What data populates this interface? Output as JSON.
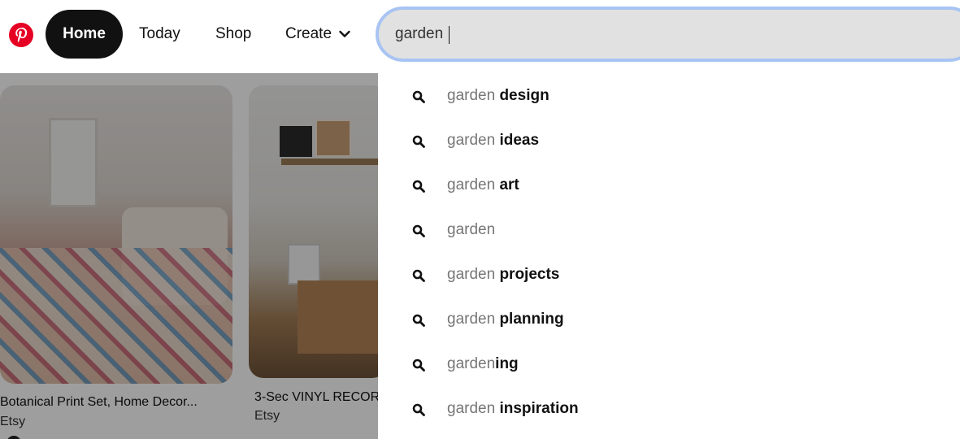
{
  "header": {
    "logo": "pinterest-logo",
    "nav": {
      "home": "Home",
      "today": "Today",
      "shop": "Shop",
      "create": "Create"
    },
    "search": {
      "value": "garden"
    }
  },
  "feed": {
    "pins": [
      {
        "title": "Botanical Print Set, Home Decor...",
        "source": "Etsy"
      },
      {
        "title": "3-Sec VINYL RECOR",
        "source": "Etsy"
      }
    ]
  },
  "suggestions": [
    {
      "base": "garden",
      "rest": " design"
    },
    {
      "base": "garden",
      "rest": " ideas"
    },
    {
      "base": "garden",
      "rest": " art"
    },
    {
      "base": "garden",
      "rest": ""
    },
    {
      "base": "garden",
      "rest": " projects"
    },
    {
      "base": "garden",
      "rest": " planning"
    },
    {
      "base": "garden",
      "rest": "ing"
    },
    {
      "base": "garden",
      "rest": " inspiration"
    }
  ],
  "colors": {
    "brand": "#e60023",
    "nav_active_bg": "#111111",
    "search_bg": "#e1e1e1",
    "search_focus": "#a8c4f2",
    "suggestion_base": "#767676"
  }
}
